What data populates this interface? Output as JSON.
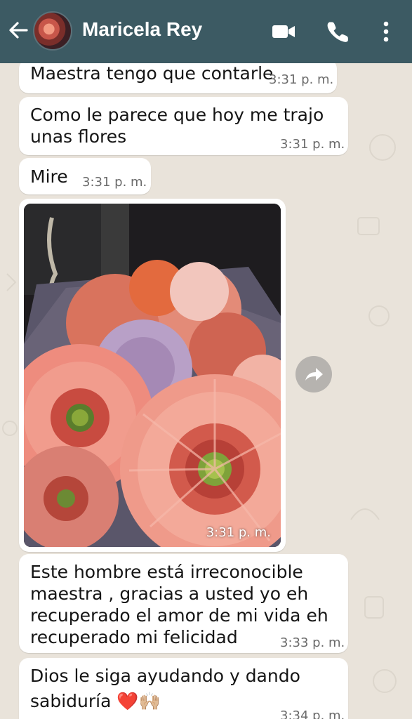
{
  "header": {
    "contact_name": "Maricela Rey",
    "background_color": "#3c5a63",
    "icons": [
      "back-arrow-icon",
      "video-call-icon",
      "phone-call-icon",
      "more-vert-icon"
    ]
  },
  "messages": [
    {
      "lines": [
        "Maestra tengo que contarle"
      ],
      "time": "3:31 p. m."
    },
    {
      "lines": [
        "Como le parece que hoy me trajo",
        "unas flores"
      ],
      "time": "3:31 p. m."
    },
    {
      "lines": [
        "Mire"
      ],
      "time": "3:31 p. m."
    },
    {
      "type": "image",
      "description_icon": "flowers-photo",
      "time": "3:31 p. m."
    },
    {
      "lines": [
        "Este hombre está irreconocible",
        "maestra , gracias a usted yo eh",
        "recuperado el amor de mi vida eh",
        "recuperado mi felicidad"
      ],
      "time": "3:33 p. m."
    },
    {
      "lines": [
        "Dios le siga ayudando y dando",
        "sabiduría ❤️🙌🏼"
      ],
      "time": "3:34 p. m."
    }
  ],
  "colors": {
    "chat_background": "#e9e3da",
    "bubble": "#ffffff",
    "time_text": "#6b6b6b"
  }
}
